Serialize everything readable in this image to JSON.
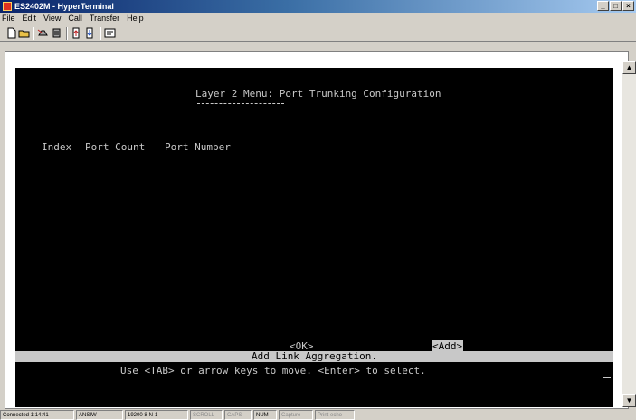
{
  "window": {
    "title": "ES2402M - HyperTerminal"
  },
  "menubar": [
    "File",
    "Edit",
    "View",
    "Call",
    "Transfer",
    "Help"
  ],
  "toolbar": {
    "icons": [
      "new-document-icon",
      "open-folder-icon",
      "dial-phone-icon",
      "disconnect-icon",
      "send-file-icon",
      "receive-file-icon",
      "properties-icon"
    ]
  },
  "terminal": {
    "title": "Layer 2 Menu: Port Trunking Configuration",
    "columns": [
      "Index",
      "Port Count",
      "Port Number"
    ],
    "buttons": {
      "ok": "<OK>",
      "add": "<Add>"
    },
    "status_text": "Add Link Aggregation.",
    "help_text": "Use <TAB> or arrow keys to move. <Enter> to select."
  },
  "statusbar": {
    "connected": "Connected 1:14:41",
    "emulation": "ANSIW",
    "settings": "19200 8-N-1",
    "indicators": [
      "SCROLL",
      "CAPS",
      "NUM",
      "Capture",
      "Print echo"
    ]
  }
}
